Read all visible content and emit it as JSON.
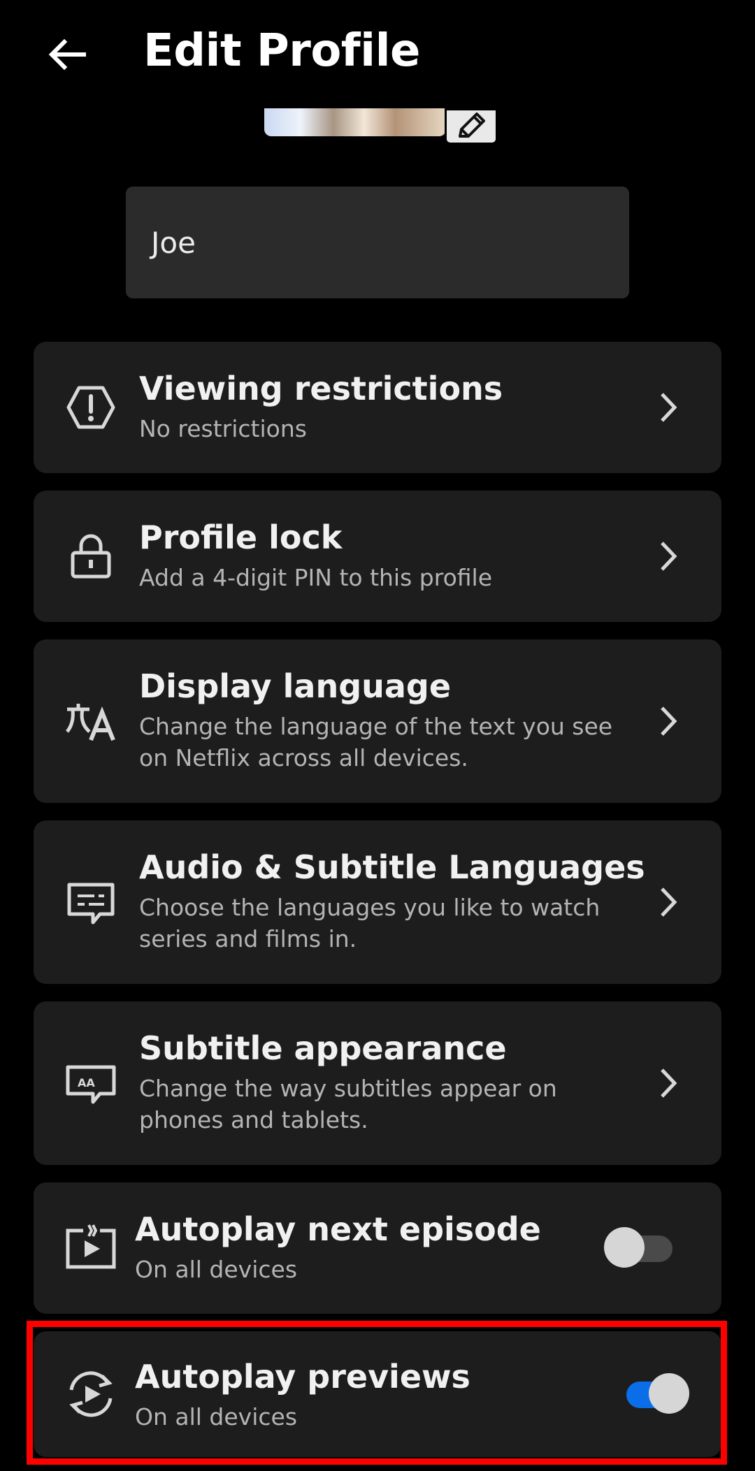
{
  "header": {
    "title": "Edit Profile",
    "back_icon": "arrow-left-icon"
  },
  "profile": {
    "name": "Joe",
    "edit_icon": "pencil-icon"
  },
  "settings": [
    {
      "title": "Viewing restrictions",
      "subtitle": "No restrictions",
      "icon": "warning-hexagon-icon"
    },
    {
      "title": "Profile lock",
      "subtitle": "Add a 4-digit PIN to this profile",
      "icon": "lock-icon"
    },
    {
      "title": "Display language",
      "subtitle": "Change the language of the text you see on Netflix across all devices.",
      "icon": "translate-icon"
    },
    {
      "title": "Audio & Subtitle Languages",
      "subtitle": "Choose the languages you like to watch series and films in.",
      "icon": "subtitles-icon"
    },
    {
      "title": "Subtitle appearance",
      "subtitle": "Change the way subtitles appear on phones and tablets.",
      "icon": "subtitle-appearance-icon"
    },
    {
      "title": "Autoplay next episode",
      "subtitle": "On all devices",
      "icon": "autoplay-next-icon",
      "toggle_on": false
    },
    {
      "title": "Autoplay previews",
      "subtitle": "On all devices",
      "icon": "autoplay-previews-icon",
      "toggle_on": true
    }
  ],
  "colors": {
    "toggle_on": "#0a6ee8",
    "toggle_off": "#4a4a4a",
    "highlight": "#ff0000"
  }
}
